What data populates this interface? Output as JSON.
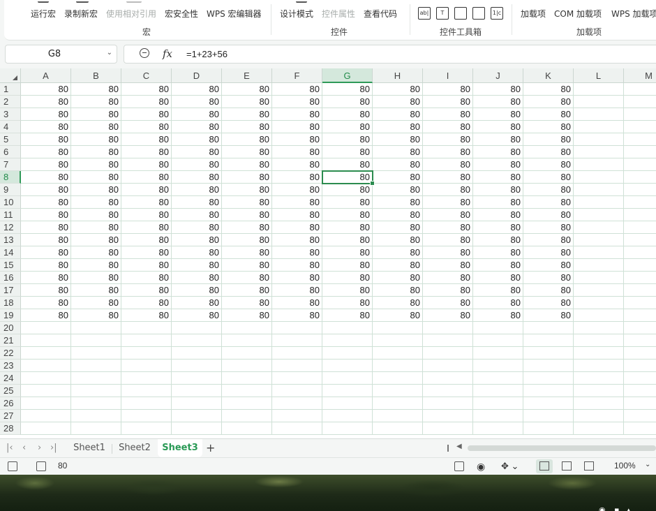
{
  "ribbon": {
    "groups": [
      {
        "label": "宏",
        "buttons": [
          {
            "label": "运行宏",
            "disabled": false
          },
          {
            "label": "录制新宏",
            "disabled": false
          },
          {
            "label": "使用相对引用",
            "disabled": true
          },
          {
            "label": "宏安全性",
            "disabled": false
          },
          {
            "label": "WPS 宏编辑器",
            "disabled": false
          }
        ]
      },
      {
        "label": "控件",
        "buttons": [
          {
            "label": "设计模式",
            "disabled": false
          },
          {
            "label": "控件属性",
            "disabled": true
          },
          {
            "label": "查看代码",
            "disabled": false
          }
        ]
      },
      {
        "label": "控件工具箱",
        "icons": [
          "ab|",
          "T",
          "img",
          "list",
          "1|c"
        ]
      },
      {
        "label": "加载项",
        "buttons": [
          {
            "label": "加载项",
            "disabled": false
          },
          {
            "label": "COM 加载项",
            "disabled": false
          },
          {
            "label": "WPS 加载项",
            "disabled": false
          }
        ]
      }
    ]
  },
  "formula_bar": {
    "name_box": "G8",
    "fx_label": "fx",
    "formula": "=1+23+56"
  },
  "grid": {
    "columns": [
      "A",
      "B",
      "C",
      "D",
      "E",
      "F",
      "G",
      "H",
      "I",
      "J",
      "K",
      "L",
      "M"
    ],
    "selected_column": "G",
    "selected_row": 8,
    "visible_rows": 28,
    "filled_rows": 19,
    "filled_columns": 11,
    "cell_value": "80",
    "active_cell": "G8"
  },
  "sheets": {
    "tabs": [
      "Sheet1",
      "Sheet2",
      "Sheet3"
    ],
    "active": "Sheet3",
    "add_label": "+"
  },
  "status_bar": {
    "value": "80",
    "zoom": "100%"
  },
  "colors": {
    "accent": "#2a9a56",
    "header_bg": "#eef2f0",
    "selected_header_bg": "#d4e8dc",
    "gridline": "#cfe1d6"
  }
}
